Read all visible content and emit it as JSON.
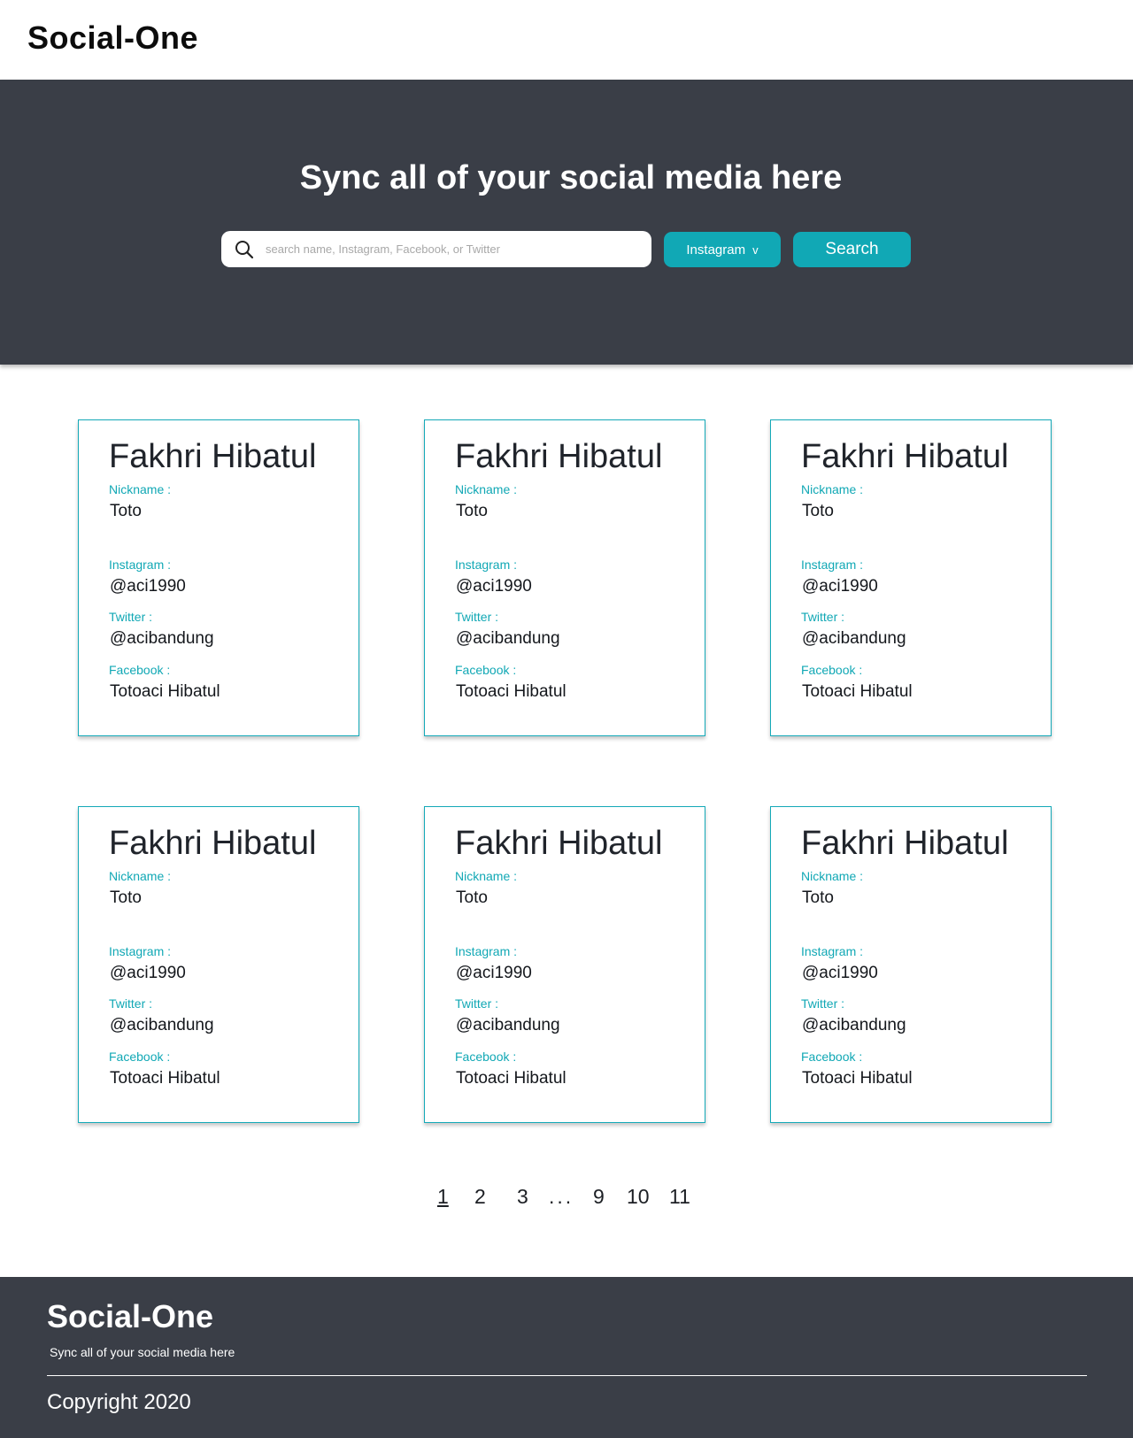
{
  "brand": "Social-One",
  "hero": {
    "title": "Sync all of your social media here",
    "search_placeholder": "search name, Instagram, Facebook, or Twitter",
    "dropdown_selected": "Instagram",
    "dropdown_chevron": "v",
    "search_button": "Search"
  },
  "labels": {
    "nickname": "Nickname :",
    "instagram": "Instagram :",
    "twitter": "Twitter :",
    "facebook": "Facebook :"
  },
  "cards": [
    {
      "name": "Fakhri Hibatul",
      "nickname": "Toto",
      "instagram": "@aci1990",
      "twitter": "@acibandung",
      "facebook": "Totoaci Hibatul"
    },
    {
      "name": "Fakhri Hibatul",
      "nickname": "Toto",
      "instagram": "@aci1990",
      "twitter": "@acibandung",
      "facebook": "Totoaci Hibatul"
    },
    {
      "name": "Fakhri Hibatul",
      "nickname": "Toto",
      "instagram": "@aci1990",
      "twitter": "@acibandung",
      "facebook": "Totoaci Hibatul"
    },
    {
      "name": "Fakhri Hibatul",
      "nickname": "Toto",
      "instagram": "@aci1990",
      "twitter": "@acibandung",
      "facebook": "Totoaci Hibatul"
    },
    {
      "name": "Fakhri Hibatul",
      "nickname": "Toto",
      "instagram": "@aci1990",
      "twitter": "@acibandung",
      "facebook": "Totoaci Hibatul"
    },
    {
      "name": "Fakhri Hibatul",
      "nickname": "Toto",
      "instagram": "@aci1990",
      "twitter": "@acibandung",
      "facebook": "Totoaci Hibatul"
    }
  ],
  "pagination": {
    "pages": [
      "1",
      "2",
      "3",
      "...",
      "9",
      "10",
      "11"
    ],
    "current": "1"
  },
  "footer": {
    "brand": "Social-One",
    "tagline": "Sync all of your social media here",
    "copyright": "Copyright 2020"
  },
  "colors": {
    "accent": "#11a8b5",
    "dark_band": "#3a3e47"
  }
}
